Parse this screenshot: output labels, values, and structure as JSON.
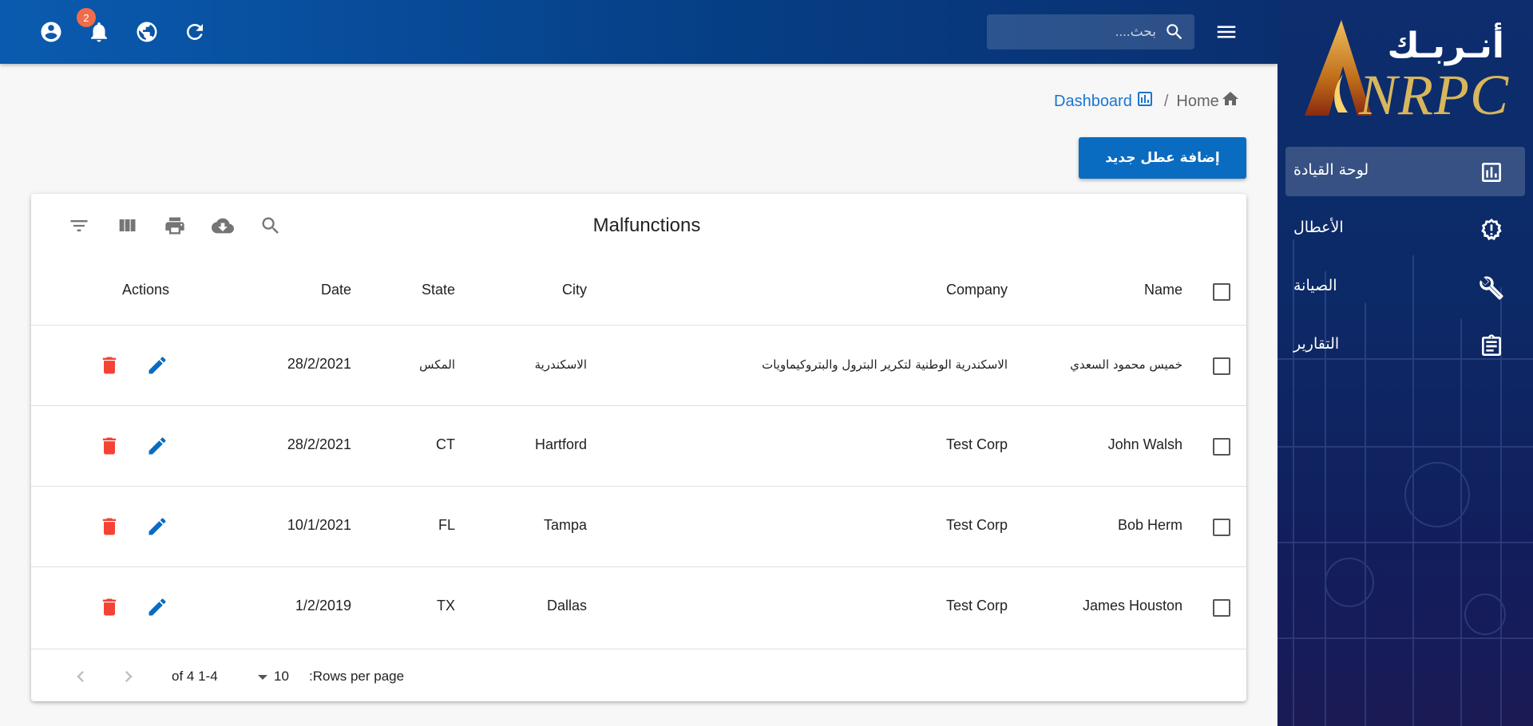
{
  "header": {
    "search_placeholder": "بحث....",
    "notification_count": "2"
  },
  "sidebar": {
    "logo_arabic": "أنـربـك",
    "logo_latin": "NRPC",
    "items": [
      {
        "label": "لوحة القيادة",
        "icon": "dashboard-chart-icon",
        "active": true
      },
      {
        "label": "الأعطال",
        "icon": "alert-gear-icon",
        "active": false
      },
      {
        "label": "الصيانة",
        "icon": "wrench-icon",
        "active": false
      },
      {
        "label": "التقارير",
        "icon": "clipboard-icon",
        "active": false
      }
    ]
  },
  "breadcrumb": {
    "dashboard": "Dashboard",
    "separator": "/",
    "home": "Home"
  },
  "add_button": "إضافة عطل جديد",
  "table": {
    "title": "Malfunctions",
    "columns": {
      "name": "Name",
      "company": "Company",
      "city": "City",
      "state": "State",
      "date": "Date",
      "actions": "Actions"
    },
    "rows": [
      {
        "name": "خميس محمود السعدي",
        "company": "الاسكندرية الوطنية لتكرير البترول والبتروكيماويات",
        "city": "الاسكندرية",
        "state": "المكس",
        "date": "28/2/2021"
      },
      {
        "name": "John Walsh",
        "company": "Test Corp",
        "city": "Hartford",
        "state": "CT",
        "date": "28/2/2021"
      },
      {
        "name": "Bob Herm",
        "company": "Test Corp",
        "city": "Tampa",
        "state": "FL",
        "date": "10/1/2021"
      },
      {
        "name": "James Houston",
        "company": "Test Corp",
        "city": "Dallas",
        "state": "TX",
        "date": "1/2/2019"
      }
    ],
    "footer": {
      "rows_per_page_label": ":Rows per page",
      "rows_per_page": "10",
      "range": "1-4 of 4"
    }
  },
  "colors": {
    "primary": "#0a6cc0",
    "delete": "#f44336",
    "edit": "#0a6cc0",
    "sidebar": "#0c2a67"
  }
}
